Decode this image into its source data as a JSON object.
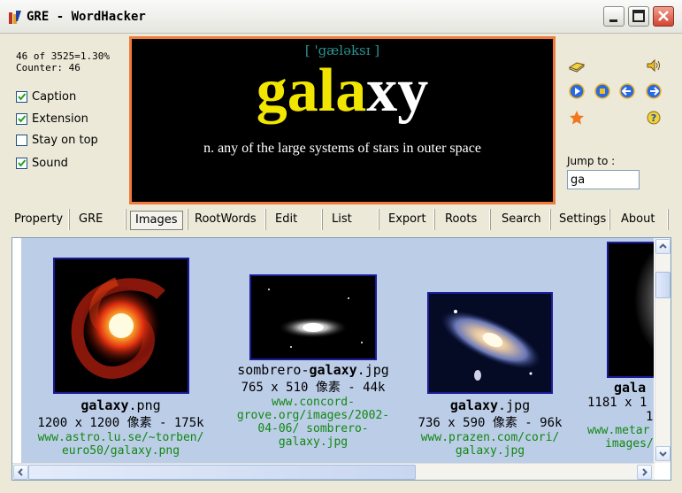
{
  "window": {
    "title": "GRE - WordHacker"
  },
  "stats": {
    "progress": "46 of 3525=1.30%",
    "counter": "Counter: 46"
  },
  "options": [
    {
      "label": "Caption",
      "checked": true
    },
    {
      "label": "Extension",
      "checked": true
    },
    {
      "label": "Stay on top",
      "checked": false
    },
    {
      "label": "Sound",
      "checked": true
    }
  ],
  "display": {
    "phonetic": "[ 'gæləksɪ ]",
    "word_highlight": "gala",
    "word_rest": "xy",
    "definition": "n.  any of the large systems of stars in outer space",
    "highlight_color": "#f2e600",
    "border_color": "#f07a3a"
  },
  "controls": {
    "icons": [
      "book-icon",
      "speaker-icon",
      "play-icon",
      "stop-icon",
      "back-icon",
      "forward-icon",
      "star-icon",
      "help-icon"
    ]
  },
  "jump": {
    "label": "Jump to :",
    "value": "ga"
  },
  "tabs": [
    "Property",
    "GRE",
    "Images",
    "RootWords",
    "Edit",
    "List",
    "Export",
    "Roots",
    "Search",
    "Settings",
    "About"
  ],
  "active_tab": "Images",
  "images": [
    {
      "name_bold": "galaxy",
      "name_rest": ".png",
      "size": "1200 x 1200 像素 - 175k",
      "url1": "www.astro.lu.se/~torben/",
      "url2": "euro50/galaxy.png"
    },
    {
      "name_pre": "sombrero-",
      "name_bold": "galaxy",
      "name_rest": ".jpg",
      "size": "765 x 510 像素 - 44k",
      "url1": "www.concord-",
      "url2": "grove.org/images/2002-",
      "url3": "04-06/ sombrero-",
      "url4": "galaxy.jpg"
    },
    {
      "name_bold": "galaxy",
      "name_rest": ".jpg",
      "size": "736 x 590 像素 - 96k",
      "url1": "www.prazen.com/cori/",
      "url2": "galaxy.jpg"
    },
    {
      "name_bold": "gala",
      "size": "1181 x 1",
      "size2": "1",
      "url1": "www.metar",
      "url2": "images/"
    }
  ]
}
